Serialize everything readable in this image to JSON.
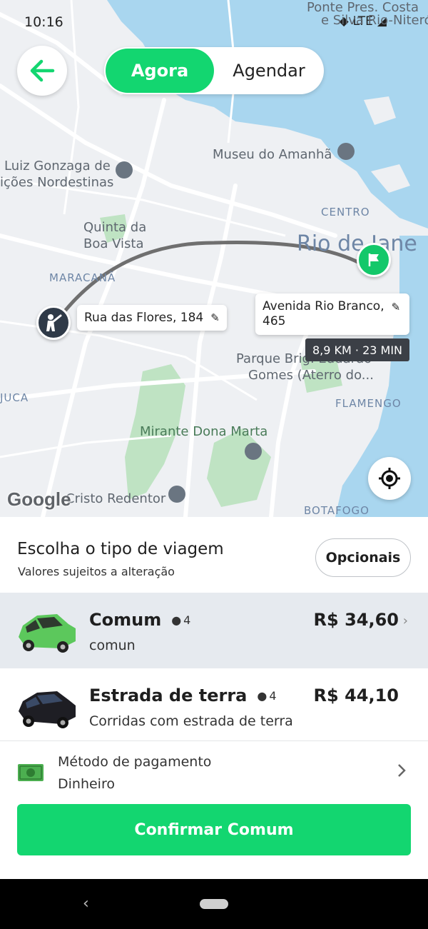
{
  "status_bar": {
    "time": "10:16",
    "network": "LTE"
  },
  "header": {
    "tab_now": "Agora",
    "tab_schedule": "Agendar"
  },
  "map": {
    "labels": {
      "ponte": "Ponte Pres. Costa",
      "ponte2": "e Silva Rio-Niterói",
      "museu": "Museu do Amanhã",
      "luiz1": "Luiz Gonzaga de",
      "luiz2": "ições Nordestinas",
      "centro": "CENTRO",
      "rio": "Rio de Jane",
      "quinta1": "Quinta da",
      "quinta2": "Boa Vista",
      "maracana": "MARACANÃ",
      "parque1": "Parque Brig. Eduardo",
      "parque2": "Gomes (Aterro do...",
      "flamengo": "FLAMENGO",
      "juca": "JUCA",
      "mirante": "Mirante Dona Marta",
      "cristo": "Cristo Redentor",
      "botafogo": "BOTAFOGO",
      "google": "Google"
    },
    "origin_address": "Rua das Flores, 184",
    "destination_address_line1": "Avenida Rio Branco,",
    "destination_address_line2": "465",
    "eta": "8,9 KM · 23 MIN"
  },
  "sheet": {
    "title": "Escolha o tipo de viagem",
    "subtitle": "Valores sujeitos a alteração",
    "options_button": "Opcionais",
    "rides": [
      {
        "name": "Comum",
        "seats": "4",
        "description": "comun",
        "price": "R$ 34,60",
        "color": "#5cc85c"
      },
      {
        "name": "Estrada de terra",
        "seats": "4",
        "description": "Corridas com estrada de terra",
        "price": "R$ 44,10",
        "color": "#1e1e24"
      }
    ],
    "payment": {
      "label": "Método de pagamento",
      "value": "Dinheiro"
    },
    "confirm_button": "Confirmar Comum"
  },
  "colors": {
    "accent": "#13d670",
    "water": "#a9d6ef",
    "park": "#bfe3c3"
  }
}
